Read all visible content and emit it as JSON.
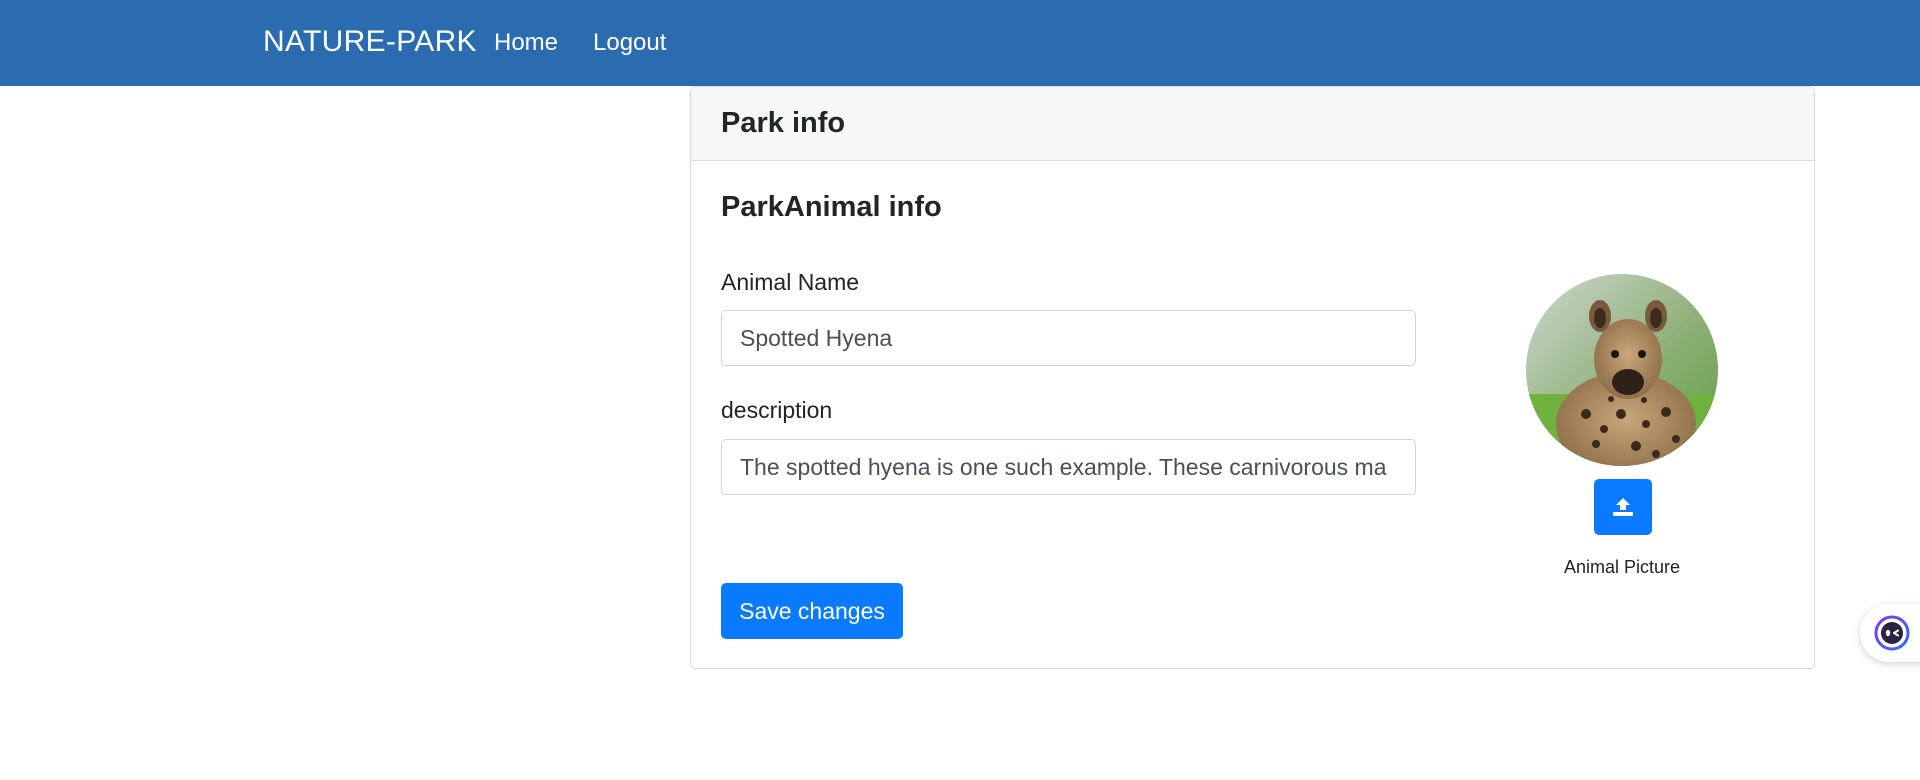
{
  "navbar": {
    "brand": "NATURE-PARK",
    "links": [
      "Home",
      "Logout"
    ],
    "background_color": "#2b6cb0"
  },
  "card": {
    "header_title": "Park info",
    "section_title": "ParkAnimal info",
    "fields": {
      "animal_name": {
        "label": "Animal Name",
        "value": "Spotted Hyena"
      },
      "description": {
        "label": "description",
        "value": "The spotted hyena is one such example. These carnivorous ma"
      }
    },
    "save_label": "Save changes",
    "picture": {
      "caption": "Animal Picture",
      "upload_icon": "upload-icon",
      "image_subject": "spotted-hyena-photo"
    }
  },
  "chat_widget": {
    "icon": "chat-bot-icon"
  },
  "colors": {
    "primary_button": "#0a7bff",
    "card_header_bg": "#f7f7f7"
  }
}
